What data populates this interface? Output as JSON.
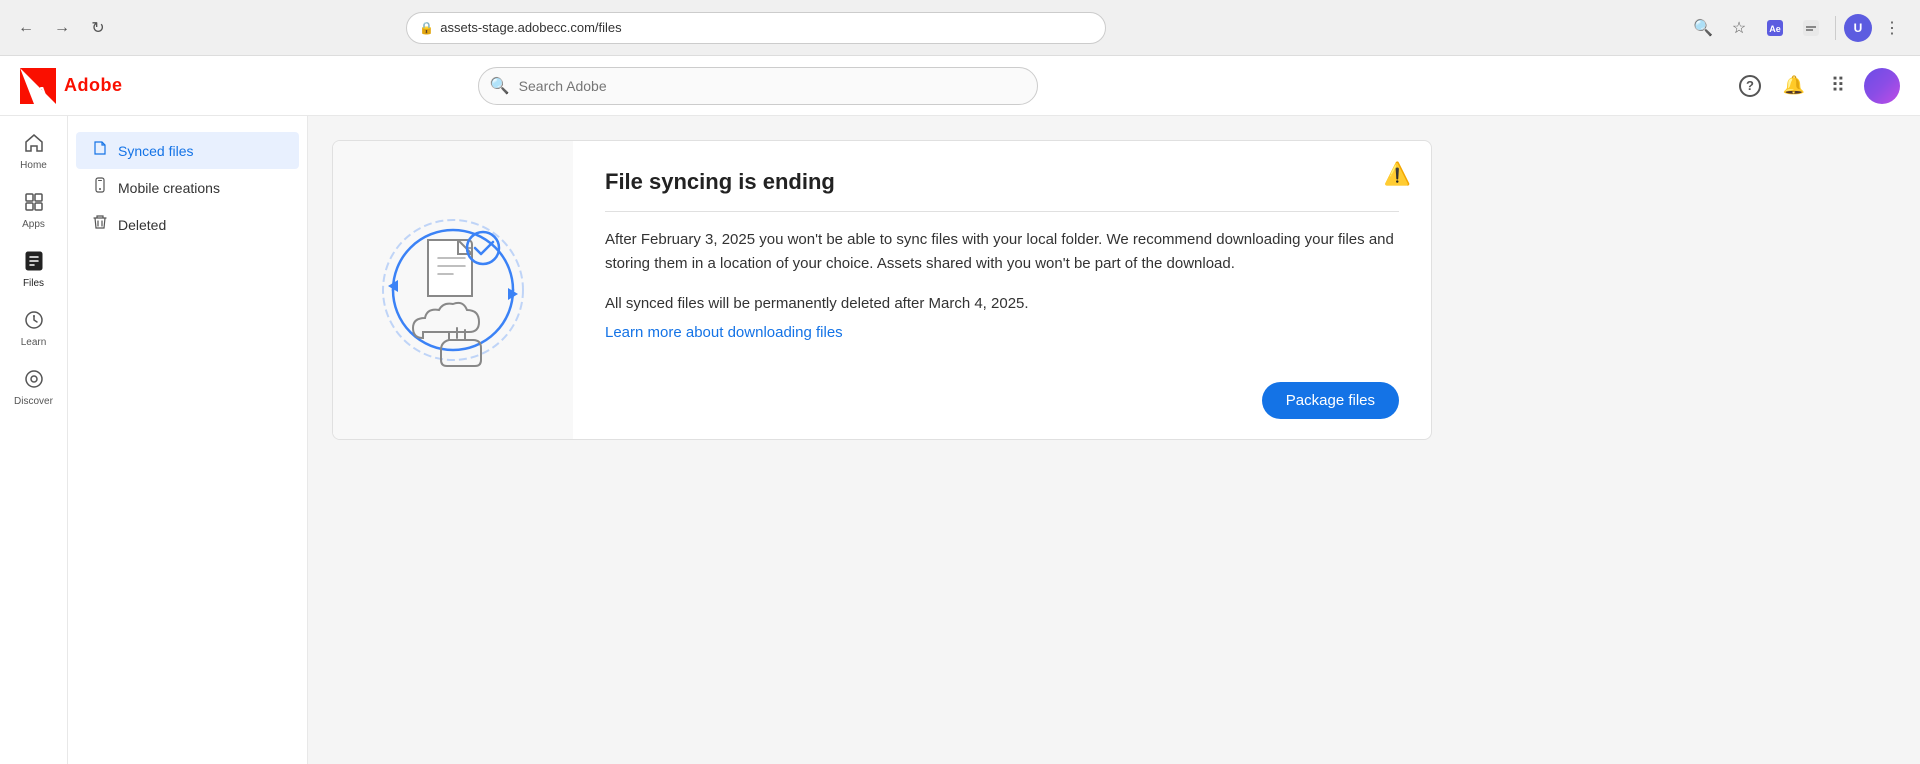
{
  "browser": {
    "url": "assets-stage.adobecc.com/files",
    "search_icon": "🔍",
    "back_icon": "←",
    "forward_icon": "→",
    "reload_icon": "↻"
  },
  "header": {
    "logo_text": "Adobe",
    "search_placeholder": "Search Adobe",
    "help_icon": "?",
    "notifications_icon": "🔔",
    "apps_grid_icon": "⠿"
  },
  "left_nav": {
    "items": [
      {
        "id": "home",
        "label": "Home",
        "icon": "⌂"
      },
      {
        "id": "apps",
        "label": "Apps",
        "icon": "⊞"
      },
      {
        "id": "files",
        "label": "Files",
        "icon": "📁",
        "active": true
      },
      {
        "id": "learn",
        "label": "Learn",
        "icon": "💡"
      },
      {
        "id": "discover",
        "label": "Discover",
        "icon": "◎"
      }
    ]
  },
  "sidebar": {
    "items": [
      {
        "id": "synced-files",
        "label": "Synced files",
        "icon": "📄",
        "active": true
      },
      {
        "id": "mobile-creations",
        "label": "Mobile creations",
        "icon": "📱"
      },
      {
        "id": "deleted",
        "label": "Deleted",
        "icon": "🗑"
      }
    ]
  },
  "banner": {
    "title": "File syncing is ending",
    "warning_icon": "⚠",
    "body_text": "After February 3, 2025 you won't be able to sync files with your local folder. We recommend downloading your files and storing them in a location of your choice. Assets shared with you won't be part of the download.",
    "sub_text": "All synced files will be permanently deleted after March 4, 2025.",
    "link_text": "Learn more about downloading files",
    "package_files_label": "Package files"
  }
}
